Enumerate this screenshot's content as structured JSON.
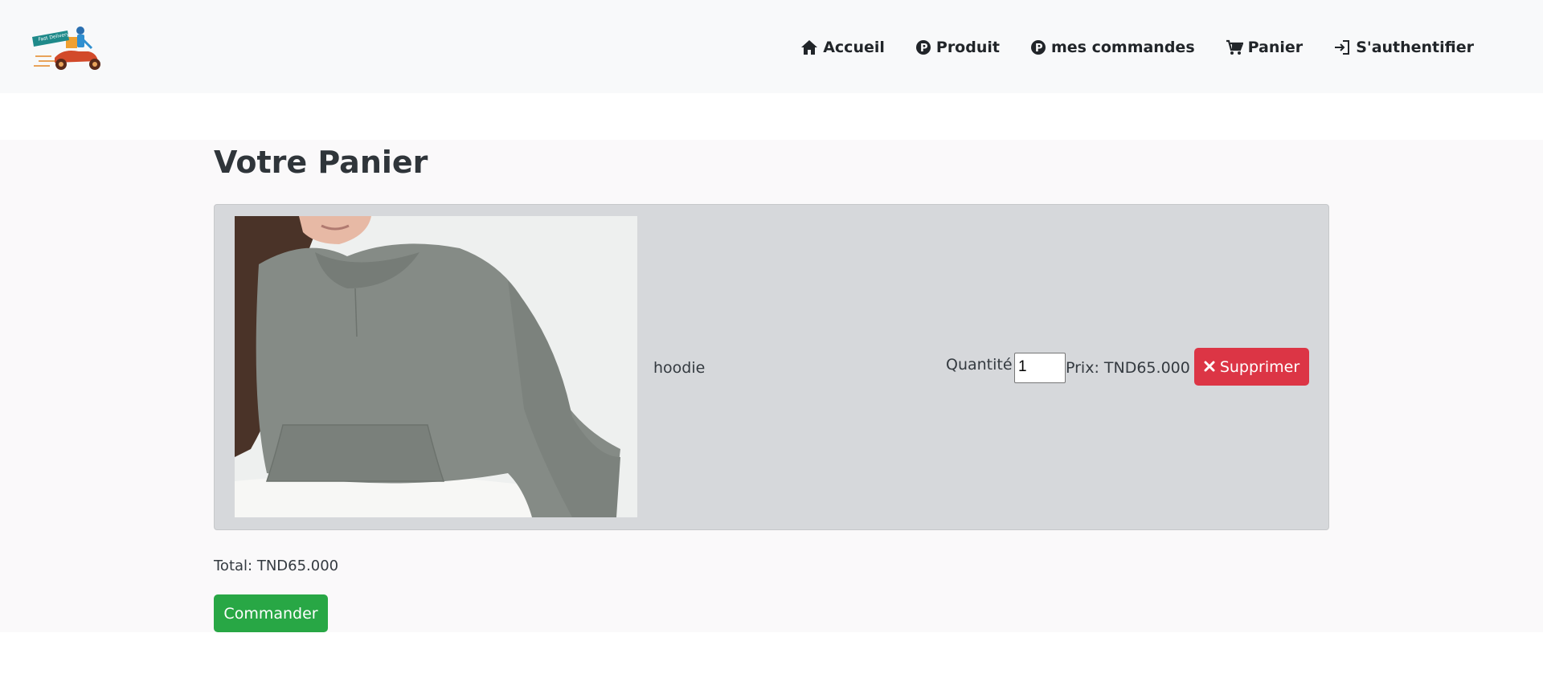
{
  "navbar": {
    "logo_text": "Fast Delivery",
    "links": [
      {
        "label": "Accueil",
        "icon": "home-icon"
      },
      {
        "label": "Produit",
        "icon": "p-circle-icon"
      },
      {
        "label": "mes commandes",
        "icon": "p-circle-icon"
      },
      {
        "label": "Panier",
        "icon": "cart-icon"
      },
      {
        "label": "S'authentifier",
        "icon": "sign-in-icon"
      }
    ]
  },
  "cart": {
    "title": "Votre Panier",
    "items": [
      {
        "name": "hoodie",
        "quantity_label": "Quantité :",
        "quantity": "1",
        "price": "Prix: TND65.000",
        "delete_label": "Supprimer"
      }
    ],
    "total": "Total: TND65.000",
    "order_label": "Commander"
  },
  "colors": {
    "navbar_bg": "#f8f9fa",
    "card_bg": "#d6d8db",
    "danger": "#dc3545",
    "success": "#28a745"
  }
}
